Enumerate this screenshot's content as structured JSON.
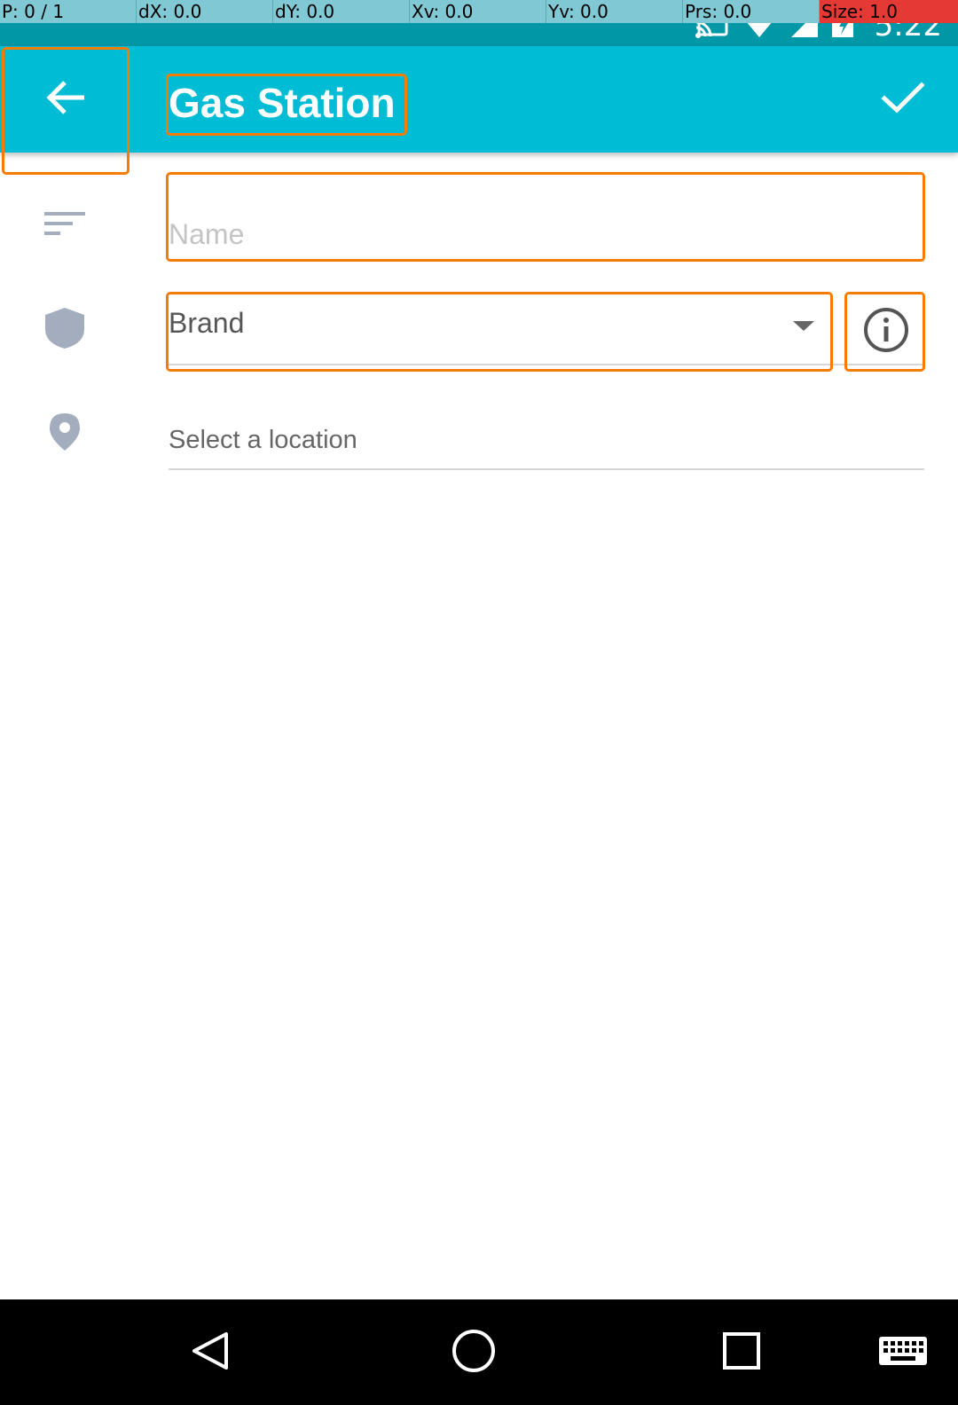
{
  "debug_overlay": {
    "pointer": "P: 0 / 1",
    "dx": "dX: 0.0",
    "dy": "dY: 0.0",
    "xv": "Xv: 0.0",
    "yv": "Yv: 0.0",
    "prs": "Prs: 0.0",
    "size": "Size: 1.0"
  },
  "status_bar": {
    "time": "5:22",
    "icons": [
      "cast-icon",
      "wifi-icon",
      "signal-icon",
      "battery-charging-icon"
    ]
  },
  "app_bar": {
    "title": "Gas Station",
    "back_icon": "arrow-back-icon",
    "confirm_icon": "check-icon"
  },
  "form": {
    "name": {
      "icon": "notes-icon",
      "placeholder": "Name",
      "value": ""
    },
    "brand": {
      "icon": "shield-icon",
      "label": "Brand",
      "dropdown_icon": "dropdown-arrow-icon",
      "info_icon": "info-icon"
    },
    "location": {
      "icon": "location-pin-icon",
      "label": "Select a location"
    }
  },
  "nav_bar": {
    "buttons": [
      "back-nav-icon",
      "home-nav-icon",
      "recents-nav-icon",
      "keyboard-icon"
    ]
  },
  "colors": {
    "app_bar": "#00bcd4",
    "status_bar": "#0097a7",
    "highlight": "#f57c00",
    "form_icon": "#a3adbd"
  }
}
